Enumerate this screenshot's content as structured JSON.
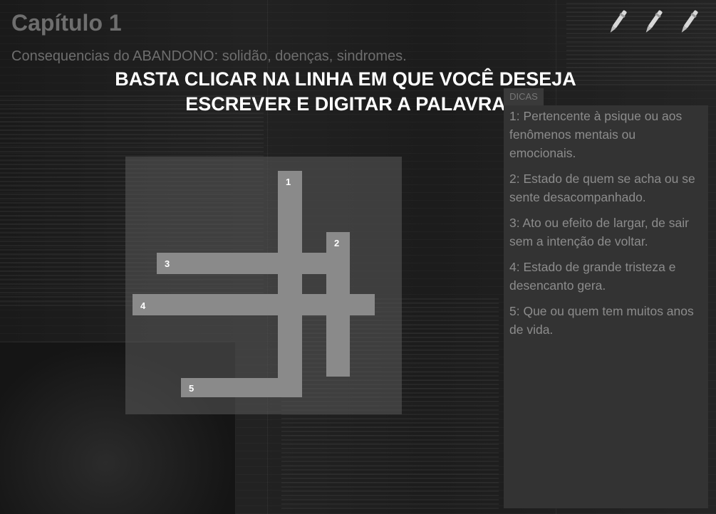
{
  "header": {
    "chapter_title": "Capítulo 1",
    "chapter_subtitle": "Consequencias do ABANDONO: solidão, doenças, sindromes."
  },
  "instruction": {
    "line1": "BASTA CLICAR NA LINHA EM QUE VOCÊ DESEJA",
    "line2": "ESCREVER E DIGITAR A PALAVRA"
  },
  "toolbar": {
    "icons": [
      "pen-icon",
      "pen-icon",
      "pen-icon"
    ]
  },
  "crossword": {
    "numbers": [
      "1",
      "2",
      "3",
      "4",
      "5"
    ],
    "words": [
      {
        "number": "1",
        "direction": "down"
      },
      {
        "number": "2",
        "direction": "down"
      },
      {
        "number": "3",
        "direction": "across"
      },
      {
        "number": "4",
        "direction": "across"
      },
      {
        "number": "5",
        "direction": "across"
      }
    ]
  },
  "hints": {
    "tab_label": "DICAS",
    "items": [
      "1: Pertencente à psique ou aos fenômenos mentais ou emocionais.",
      "2: Estado de quem se acha ou se sente desacompanhado.",
      "3: Ato ou efeito de largar, de sair sem a intenção de voltar.",
      "4: Estado de grande tristeza e desencanto gera.",
      "5: Que ou quem tem muitos anos de vida."
    ]
  },
  "colors": {
    "cell": "#8a8a8a",
    "panel": "#333333",
    "instruction_text": "#ffffff"
  }
}
